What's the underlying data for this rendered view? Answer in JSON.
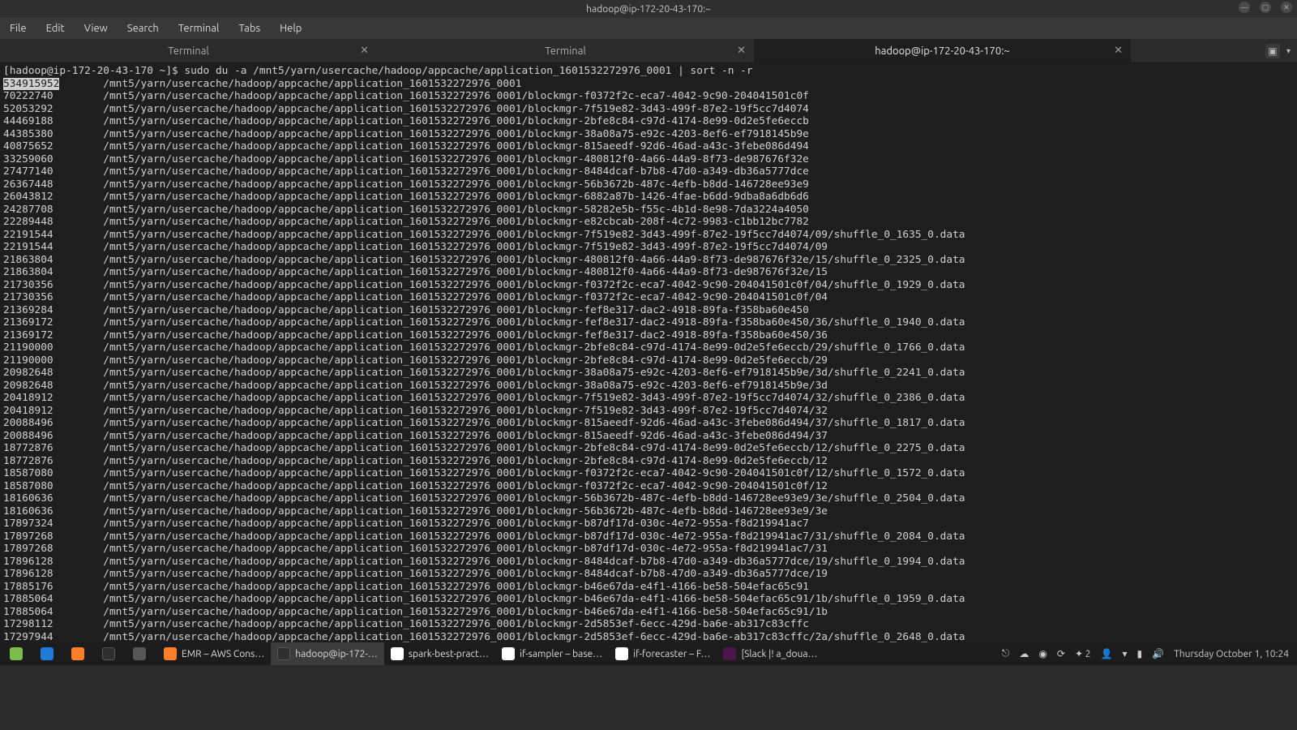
{
  "window": {
    "title": "hadoop@ip-172-20-43-170:~",
    "controls": {
      "min": "—",
      "max": "▢",
      "close": "✕"
    }
  },
  "menu": {
    "file": "File",
    "edit": "Edit",
    "view": "View",
    "search": "Search",
    "terminal": "Terminal",
    "tabs": "Tabs",
    "help": "Help"
  },
  "tabs": [
    {
      "label": "Terminal"
    },
    {
      "label": "Terminal"
    },
    {
      "label": "hadoop@ip-172-20-43-170:~"
    }
  ],
  "prompt": {
    "prefix": "[hadoop@ip-172-20-43-170 ~]$ ",
    "command": "sudo du -a /mnt5/yarn/usercache/hadoop/appcache/application_1601532272976_0001 | sort -n -r"
  },
  "lines": [
    {
      "s": "534915952",
      "p": "/mnt5/yarn/usercache/hadoop/appcache/application_1601532272976_0001",
      "hl": true
    },
    {
      "s": "70222740",
      "p": "/mnt5/yarn/usercache/hadoop/appcache/application_1601532272976_0001/blockmgr-f0372f2c-eca7-4042-9c90-204041501c0f"
    },
    {
      "s": "52053292",
      "p": "/mnt5/yarn/usercache/hadoop/appcache/application_1601532272976_0001/blockmgr-7f519e82-3d43-499f-87e2-19f5cc7d4074"
    },
    {
      "s": "44469188",
      "p": "/mnt5/yarn/usercache/hadoop/appcache/application_1601532272976_0001/blockmgr-2bfe8c84-c97d-4174-8e99-0d2e5fe6eccb"
    },
    {
      "s": "44385380",
      "p": "/mnt5/yarn/usercache/hadoop/appcache/application_1601532272976_0001/blockmgr-38a08a75-e92c-4203-8ef6-ef7918145b9e"
    },
    {
      "s": "40875652",
      "p": "/mnt5/yarn/usercache/hadoop/appcache/application_1601532272976_0001/blockmgr-815aeedf-92d6-46ad-a43c-3febe086d494"
    },
    {
      "s": "33259060",
      "p": "/mnt5/yarn/usercache/hadoop/appcache/application_1601532272976_0001/blockmgr-480812f0-4a66-44a9-8f73-de987676f32e"
    },
    {
      "s": "27477140",
      "p": "/mnt5/yarn/usercache/hadoop/appcache/application_1601532272976_0001/blockmgr-8484dcaf-b7b8-47d0-a349-db36a5777dce"
    },
    {
      "s": "26367448",
      "p": "/mnt5/yarn/usercache/hadoop/appcache/application_1601532272976_0001/blockmgr-56b3672b-487c-4efb-b8dd-146728ee93e9"
    },
    {
      "s": "26043812",
      "p": "/mnt5/yarn/usercache/hadoop/appcache/application_1601532272976_0001/blockmgr-6882a87b-1426-4fae-b6dd-9dba8a6db6d6"
    },
    {
      "s": "24287708",
      "p": "/mnt5/yarn/usercache/hadoop/appcache/application_1601532272976_0001/blockmgr-58282e5b-f55c-4b1d-8e98-7da3224a4050"
    },
    {
      "s": "22289448",
      "p": "/mnt5/yarn/usercache/hadoop/appcache/application_1601532272976_0001/blockmgr-e82cbcab-208f-4c72-9983-c1bb12bc7782"
    },
    {
      "s": "22191544",
      "p": "/mnt5/yarn/usercache/hadoop/appcache/application_1601532272976_0001/blockmgr-7f519e82-3d43-499f-87e2-19f5cc7d4074/09/shuffle_0_1635_0.data"
    },
    {
      "s": "22191544",
      "p": "/mnt5/yarn/usercache/hadoop/appcache/application_1601532272976_0001/blockmgr-7f519e82-3d43-499f-87e2-19f5cc7d4074/09"
    },
    {
      "s": "21863804",
      "p": "/mnt5/yarn/usercache/hadoop/appcache/application_1601532272976_0001/blockmgr-480812f0-4a66-44a9-8f73-de987676f32e/15/shuffle_0_2325_0.data"
    },
    {
      "s": "21863804",
      "p": "/mnt5/yarn/usercache/hadoop/appcache/application_1601532272976_0001/blockmgr-480812f0-4a66-44a9-8f73-de987676f32e/15"
    },
    {
      "s": "21730356",
      "p": "/mnt5/yarn/usercache/hadoop/appcache/application_1601532272976_0001/blockmgr-f0372f2c-eca7-4042-9c90-204041501c0f/04/shuffle_0_1929_0.data"
    },
    {
      "s": "21730356",
      "p": "/mnt5/yarn/usercache/hadoop/appcache/application_1601532272976_0001/blockmgr-f0372f2c-eca7-4042-9c90-204041501c0f/04"
    },
    {
      "s": "21369284",
      "p": "/mnt5/yarn/usercache/hadoop/appcache/application_1601532272976_0001/blockmgr-fef8e317-dac2-4918-89fa-f358ba60e450"
    },
    {
      "s": "21369172",
      "p": "/mnt5/yarn/usercache/hadoop/appcache/application_1601532272976_0001/blockmgr-fef8e317-dac2-4918-89fa-f358ba60e450/36/shuffle_0_1940_0.data"
    },
    {
      "s": "21369172",
      "p": "/mnt5/yarn/usercache/hadoop/appcache/application_1601532272976_0001/blockmgr-fef8e317-dac2-4918-89fa-f358ba60e450/36"
    },
    {
      "s": "21190000",
      "p": "/mnt5/yarn/usercache/hadoop/appcache/application_1601532272976_0001/blockmgr-2bfe8c84-c97d-4174-8e99-0d2e5fe6eccb/29/shuffle_0_1766_0.data"
    },
    {
      "s": "21190000",
      "p": "/mnt5/yarn/usercache/hadoop/appcache/application_1601532272976_0001/blockmgr-2bfe8c84-c97d-4174-8e99-0d2e5fe6eccb/29"
    },
    {
      "s": "20982648",
      "p": "/mnt5/yarn/usercache/hadoop/appcache/application_1601532272976_0001/blockmgr-38a08a75-e92c-4203-8ef6-ef7918145b9e/3d/shuffle_0_2241_0.data"
    },
    {
      "s": "20982648",
      "p": "/mnt5/yarn/usercache/hadoop/appcache/application_1601532272976_0001/blockmgr-38a08a75-e92c-4203-8ef6-ef7918145b9e/3d"
    },
    {
      "s": "20418912",
      "p": "/mnt5/yarn/usercache/hadoop/appcache/application_1601532272976_0001/blockmgr-7f519e82-3d43-499f-87e2-19f5cc7d4074/32/shuffle_0_2386_0.data"
    },
    {
      "s": "20418912",
      "p": "/mnt5/yarn/usercache/hadoop/appcache/application_1601532272976_0001/blockmgr-7f519e82-3d43-499f-87e2-19f5cc7d4074/32"
    },
    {
      "s": "20088496",
      "p": "/mnt5/yarn/usercache/hadoop/appcache/application_1601532272976_0001/blockmgr-815aeedf-92d6-46ad-a43c-3febe086d494/37/shuffle_0_1817_0.data"
    },
    {
      "s": "20088496",
      "p": "/mnt5/yarn/usercache/hadoop/appcache/application_1601532272976_0001/blockmgr-815aeedf-92d6-46ad-a43c-3febe086d494/37"
    },
    {
      "s": "18772876",
      "p": "/mnt5/yarn/usercache/hadoop/appcache/application_1601532272976_0001/blockmgr-2bfe8c84-c97d-4174-8e99-0d2e5fe6eccb/12/shuffle_0_2275_0.data"
    },
    {
      "s": "18772876",
      "p": "/mnt5/yarn/usercache/hadoop/appcache/application_1601532272976_0001/blockmgr-2bfe8c84-c97d-4174-8e99-0d2e5fe6eccb/12"
    },
    {
      "s": "18587080",
      "p": "/mnt5/yarn/usercache/hadoop/appcache/application_1601532272976_0001/blockmgr-f0372f2c-eca7-4042-9c90-204041501c0f/12/shuffle_0_1572_0.data"
    },
    {
      "s": "18587080",
      "p": "/mnt5/yarn/usercache/hadoop/appcache/application_1601532272976_0001/blockmgr-f0372f2c-eca7-4042-9c90-204041501c0f/12"
    },
    {
      "s": "18160636",
      "p": "/mnt5/yarn/usercache/hadoop/appcache/application_1601532272976_0001/blockmgr-56b3672b-487c-4efb-b8dd-146728ee93e9/3e/shuffle_0_2504_0.data"
    },
    {
      "s": "18160636",
      "p": "/mnt5/yarn/usercache/hadoop/appcache/application_1601532272976_0001/blockmgr-56b3672b-487c-4efb-b8dd-146728ee93e9/3e"
    },
    {
      "s": "17897324",
      "p": "/mnt5/yarn/usercache/hadoop/appcache/application_1601532272976_0001/blockmgr-b87df17d-030c-4e72-955a-f8d219941ac7"
    },
    {
      "s": "17897268",
      "p": "/mnt5/yarn/usercache/hadoop/appcache/application_1601532272976_0001/blockmgr-b87df17d-030c-4e72-955a-f8d219941ac7/31/shuffle_0_2084_0.data"
    },
    {
      "s": "17897268",
      "p": "/mnt5/yarn/usercache/hadoop/appcache/application_1601532272976_0001/blockmgr-b87df17d-030c-4e72-955a-f8d219941ac7/31"
    },
    {
      "s": "17896128",
      "p": "/mnt5/yarn/usercache/hadoop/appcache/application_1601532272976_0001/blockmgr-8484dcaf-b7b8-47d0-a349-db36a5777dce/19/shuffle_0_1994_0.data"
    },
    {
      "s": "17896128",
      "p": "/mnt5/yarn/usercache/hadoop/appcache/application_1601532272976_0001/blockmgr-8484dcaf-b7b8-47d0-a349-db36a5777dce/19"
    },
    {
      "s": "17885176",
      "p": "/mnt5/yarn/usercache/hadoop/appcache/application_1601532272976_0001/blockmgr-b46e67da-e4f1-4166-be58-504efac65c91"
    },
    {
      "s": "17885064",
      "p": "/mnt5/yarn/usercache/hadoop/appcache/application_1601532272976_0001/blockmgr-b46e67da-e4f1-4166-be58-504efac65c91/1b/shuffle_0_1959_0.data"
    },
    {
      "s": "17885064",
      "p": "/mnt5/yarn/usercache/hadoop/appcache/application_1601532272976_0001/blockmgr-b46e67da-e4f1-4166-be58-504efac65c91/1b"
    },
    {
      "s": "17298112",
      "p": "/mnt5/yarn/usercache/hadoop/appcache/application_1601532272976_0001/blockmgr-2d5853ef-6ecc-429d-ba6e-ab317c83cffc"
    },
    {
      "s": "17297944",
      "p": "/mnt5/yarn/usercache/hadoop/appcache/application_1601532272976_0001/blockmgr-2d5853ef-6ecc-429d-ba6e-ab317c83cffc/2a/shuffle_0_2648_0.data"
    }
  ],
  "panel": {
    "tasks": [
      {
        "label": "EMR – AWS Cons…",
        "icon": "ff"
      },
      {
        "label": "hadoop@ip-172-…",
        "icon": "term",
        "active": true
      },
      {
        "label": "spark-best-pract…",
        "icon": "chrome"
      },
      {
        "label": "if-sampler – base…",
        "icon": "chrome"
      },
      {
        "label": "if-forecaster – F…",
        "icon": "chrome"
      },
      {
        "label": "[Slack |! a_doua…",
        "icon": "slack"
      }
    ],
    "clock_text": "Thursday October  1, 10:24",
    "indicator_count": "2"
  }
}
